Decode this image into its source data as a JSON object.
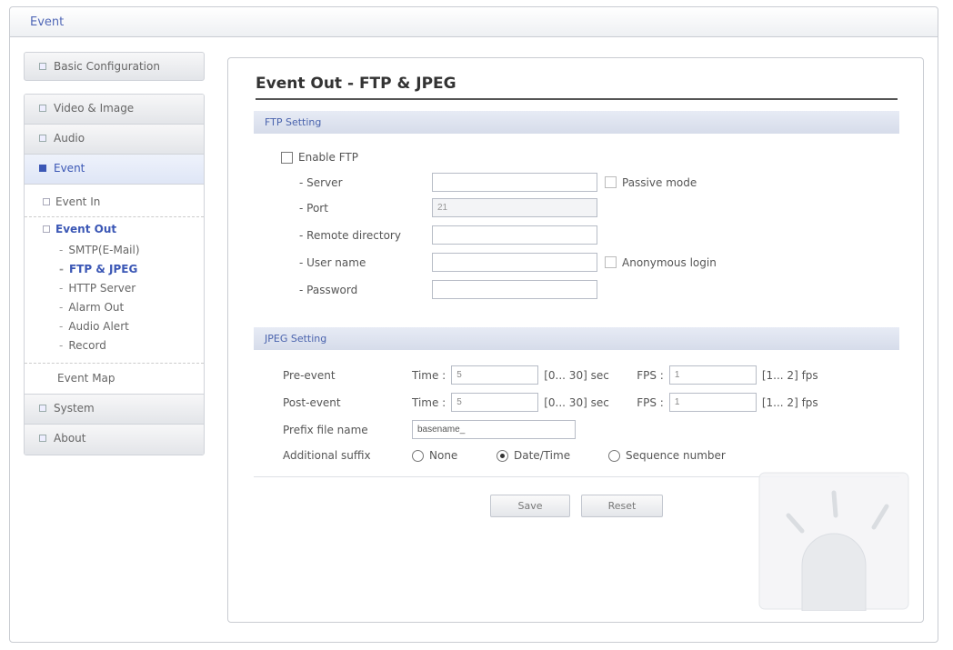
{
  "window": {
    "title": "Event"
  },
  "sidebar": {
    "basic": "Basic Configuration",
    "video": "Video & Image",
    "audio": "Audio",
    "event": "Event",
    "event_in": "Event In",
    "event_out": "Event Out",
    "smtp": "SMTP(E-Mail)",
    "ftp": "FTP & JPEG",
    "http": "HTTP Server",
    "alarm": "Alarm Out",
    "audio_alert": "Audio Alert",
    "record": "Record",
    "event_map": "Event Map",
    "system": "System",
    "about": "About"
  },
  "main": {
    "title": "Event Out - FTP & JPEG",
    "ftp_section": "FTP Setting",
    "enable_ftp": "Enable FTP",
    "server_label": "- Server",
    "server_value": "",
    "passive_label": "Passive mode",
    "port_label": "- Port",
    "port_value": "21",
    "remote_dir_label": "- Remote directory",
    "remote_dir_value": "",
    "username_label": "- User name",
    "username_value": "",
    "anon_label": "Anonymous login",
    "password_label": "- Password",
    "password_value": "",
    "jpeg_section": "JPEG Setting",
    "pre_event": "Pre-event",
    "post_event": "Post-event",
    "time_label": "Time :",
    "pre_time": "5",
    "post_time": "5",
    "time_range": "[0... 30] sec",
    "fps_label": "FPS :",
    "pre_fps": "1",
    "post_fps": "1",
    "fps_range": "[1... 2] fps",
    "prefix_label": "Prefix file name",
    "prefix_value": "basename_",
    "suffix_label": "Additional suffix",
    "suffix_none": "None",
    "suffix_date": "Date/Time",
    "suffix_seq": "Sequence number",
    "suffix_selected": "Date/Time",
    "save": "Save",
    "reset": "Reset"
  },
  "colors": {
    "accent": "#3b57b5",
    "section_bg": "#dfe4f0"
  }
}
